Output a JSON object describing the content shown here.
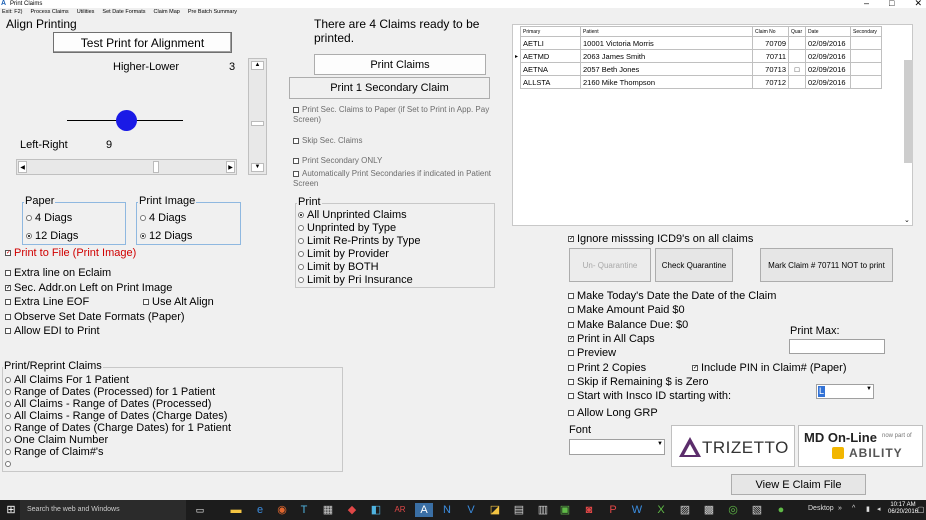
{
  "window": {
    "title": "Print Claims",
    "minimize": "–",
    "maximize": "□",
    "close": "✕"
  },
  "menu": [
    "Exit: F2)",
    "Process Claims",
    "Utilities",
    "Set Date Formats",
    "Claim Map",
    "Pre Batch Summary"
  ],
  "align": {
    "legend": "Align Printing",
    "test_print": "Test Print  for Alignment",
    "higher_lower_label": "Higher-Lower",
    "higher_lower_value": "3",
    "left_right_label": "Left-Right",
    "left_right_value": "9"
  },
  "paper": {
    "legend": "Paper",
    "opt1": "4 Diags",
    "opt2": "12 Diags",
    "selected": 2
  },
  "print_image": {
    "legend": "Print Image",
    "opt1": "4 Diags",
    "opt2": "12 Diags",
    "selected": 2
  },
  "options_left": {
    "print_to_file": "Print to File (Print Image)",
    "extra_line": "Extra line on  Eclaim",
    "sec_addr": "Sec. Addr.on Left on Print Image",
    "extra_eof": "Extra Line EOF",
    "use_alt_align": "Use Alt Align",
    "observe_date": "Observe Set Date Formats (Paper)",
    "allow_edi": "Allow EDI to Print"
  },
  "reprint": {
    "legend": "Print/Reprint Claims",
    "options": [
      "All Claims For 1 Patient",
      "Range of Dates (Processed) for 1 Patient",
      "All Claims - Range of Dates (Processed)",
      "All Claims - Range of Dates (Charge Dates)",
      "Range of Dates (Charge Dates) for 1 Patient",
      "One Claim Number",
      "Range of Claim#'s",
      ""
    ]
  },
  "middle": {
    "ready_msg": "There are 4 Claims ready to be printed.",
    "print_claims": "Print Claims",
    "print_secondary": "Print 1 Secondary Claim",
    "print_sec_paper": "Print Sec. Claims to Paper (if Set to Print in App. Pay Screen)",
    "skip_sec": "Skip Sec. Claims",
    "print_sec_only": "Print Secondary ONLY",
    "auto_print_sec": "Automatically Print Secondaries if indicated in Patient Screen"
  },
  "print_group": {
    "legend": "Print",
    "options": [
      "All Unprinted Claims",
      "Unprinted by Type",
      "Limit Re-Prints by Type",
      "Limit  by Provider",
      "Limit  by BOTH",
      "Limit by Pri Insurance"
    ],
    "selected": 0
  },
  "claims_table": {
    "headers": [
      "Primary",
      "Patient",
      "Claim No",
      "Quar",
      "Date",
      "Secondary"
    ],
    "rows": [
      {
        "primary": "AETLI",
        "patient": "10001 Victoria Morris",
        "claim": "70709",
        "quar": "",
        "date": "02/09/2016",
        "secondary": ""
      },
      {
        "primary": "AETMD",
        "patient": "2063 James Smith",
        "claim": "70711",
        "quar": "",
        "date": "02/09/2016",
        "secondary": ""
      },
      {
        "primary": "AETNA",
        "patient": "2057 Beth Jones",
        "claim": "70713",
        "quar": "□",
        "date": "02/09/2016",
        "secondary": ""
      },
      {
        "primary": "ALLSTA",
        "patient": "2160 Mike Thompson",
        "claim": "70712",
        "quar": "",
        "date": "02/09/2016",
        "secondary": ""
      }
    ]
  },
  "right": {
    "ignore_icd9": "Ignore misssing ICD9's on all claims",
    "un_quarantine": "Un- Quarantine",
    "check_quarantine": "Check Quarantine",
    "mark_claim": "Mark Claim # 70711 NOT to print",
    "todays_date": "Make Today's Date the Date of the Claim",
    "amount_paid": "Make Amount Paid $0",
    "balance_due": "Make Balance Due: $0",
    "all_caps": "Print in All Caps",
    "print_max": "Print Max:",
    "preview": "Preview",
    "print_2": "Print 2 Copies",
    "include_pin": "Include PIN in Claim# (Paper)",
    "skip_remaining": "Skip if Remaining $ is Zero",
    "start_insco": "Start with Insco ID starting with:",
    "insco_value": "L",
    "allow_long": "Allow Long GRP",
    "font_label": "Font",
    "view_eclaim": "View E Claim File"
  },
  "logos": {
    "trizetto": "TRIZETTO",
    "mdonline_1": "MD On-Line",
    "mdonline_2": "now part of",
    "mdonline_3": "ABILITY"
  },
  "taskbar": {
    "search": "Search the web and Windows",
    "desktop": "Desktop",
    "time": "10:17 AM",
    "date": "06/20/2016"
  }
}
